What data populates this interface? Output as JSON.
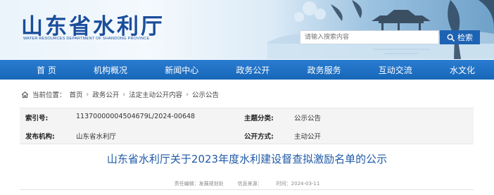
{
  "header": {
    "site_title": "山东省水利厅",
    "site_subtitle": "WATER RESOURCES DEPARTMENT OF SHANDONG PROVINCE",
    "search_placeholder": "请输入搜索内容",
    "search_button_label": "检索"
  },
  "nav": {
    "items": [
      "首 页",
      "机构概况",
      "新闻中心",
      "政务公开",
      "政务服务",
      "互动交流",
      "水文化"
    ]
  },
  "breadcrumb": {
    "prefix": "当前位置：",
    "items": [
      "首页",
      "政务公开",
      "法定主动公开内容",
      "公示公告"
    ],
    "separator": "›"
  },
  "meta": {
    "index_label": "索引号:",
    "index_value": "11370000004504679L/2024-00648",
    "category_label": "主题分类:",
    "category_value": "公示公告",
    "publisher_label": "发布机构:",
    "publisher_value": "山东省水利厅",
    "disclosure_label": "公开方式:",
    "disclosure_value": "主动公开"
  },
  "article": {
    "title": "山东省水利厅关于2023年度水利建设督查拟激励名单的公示",
    "editor": "责任编辑：发展规划处",
    "source": "信息来源：",
    "time": "时间：2024-03-11"
  },
  "colors": {
    "brand_blue": "#1a4e9c",
    "nav_blue": "#1767b8",
    "title_blue": "#1f5aa6"
  }
}
